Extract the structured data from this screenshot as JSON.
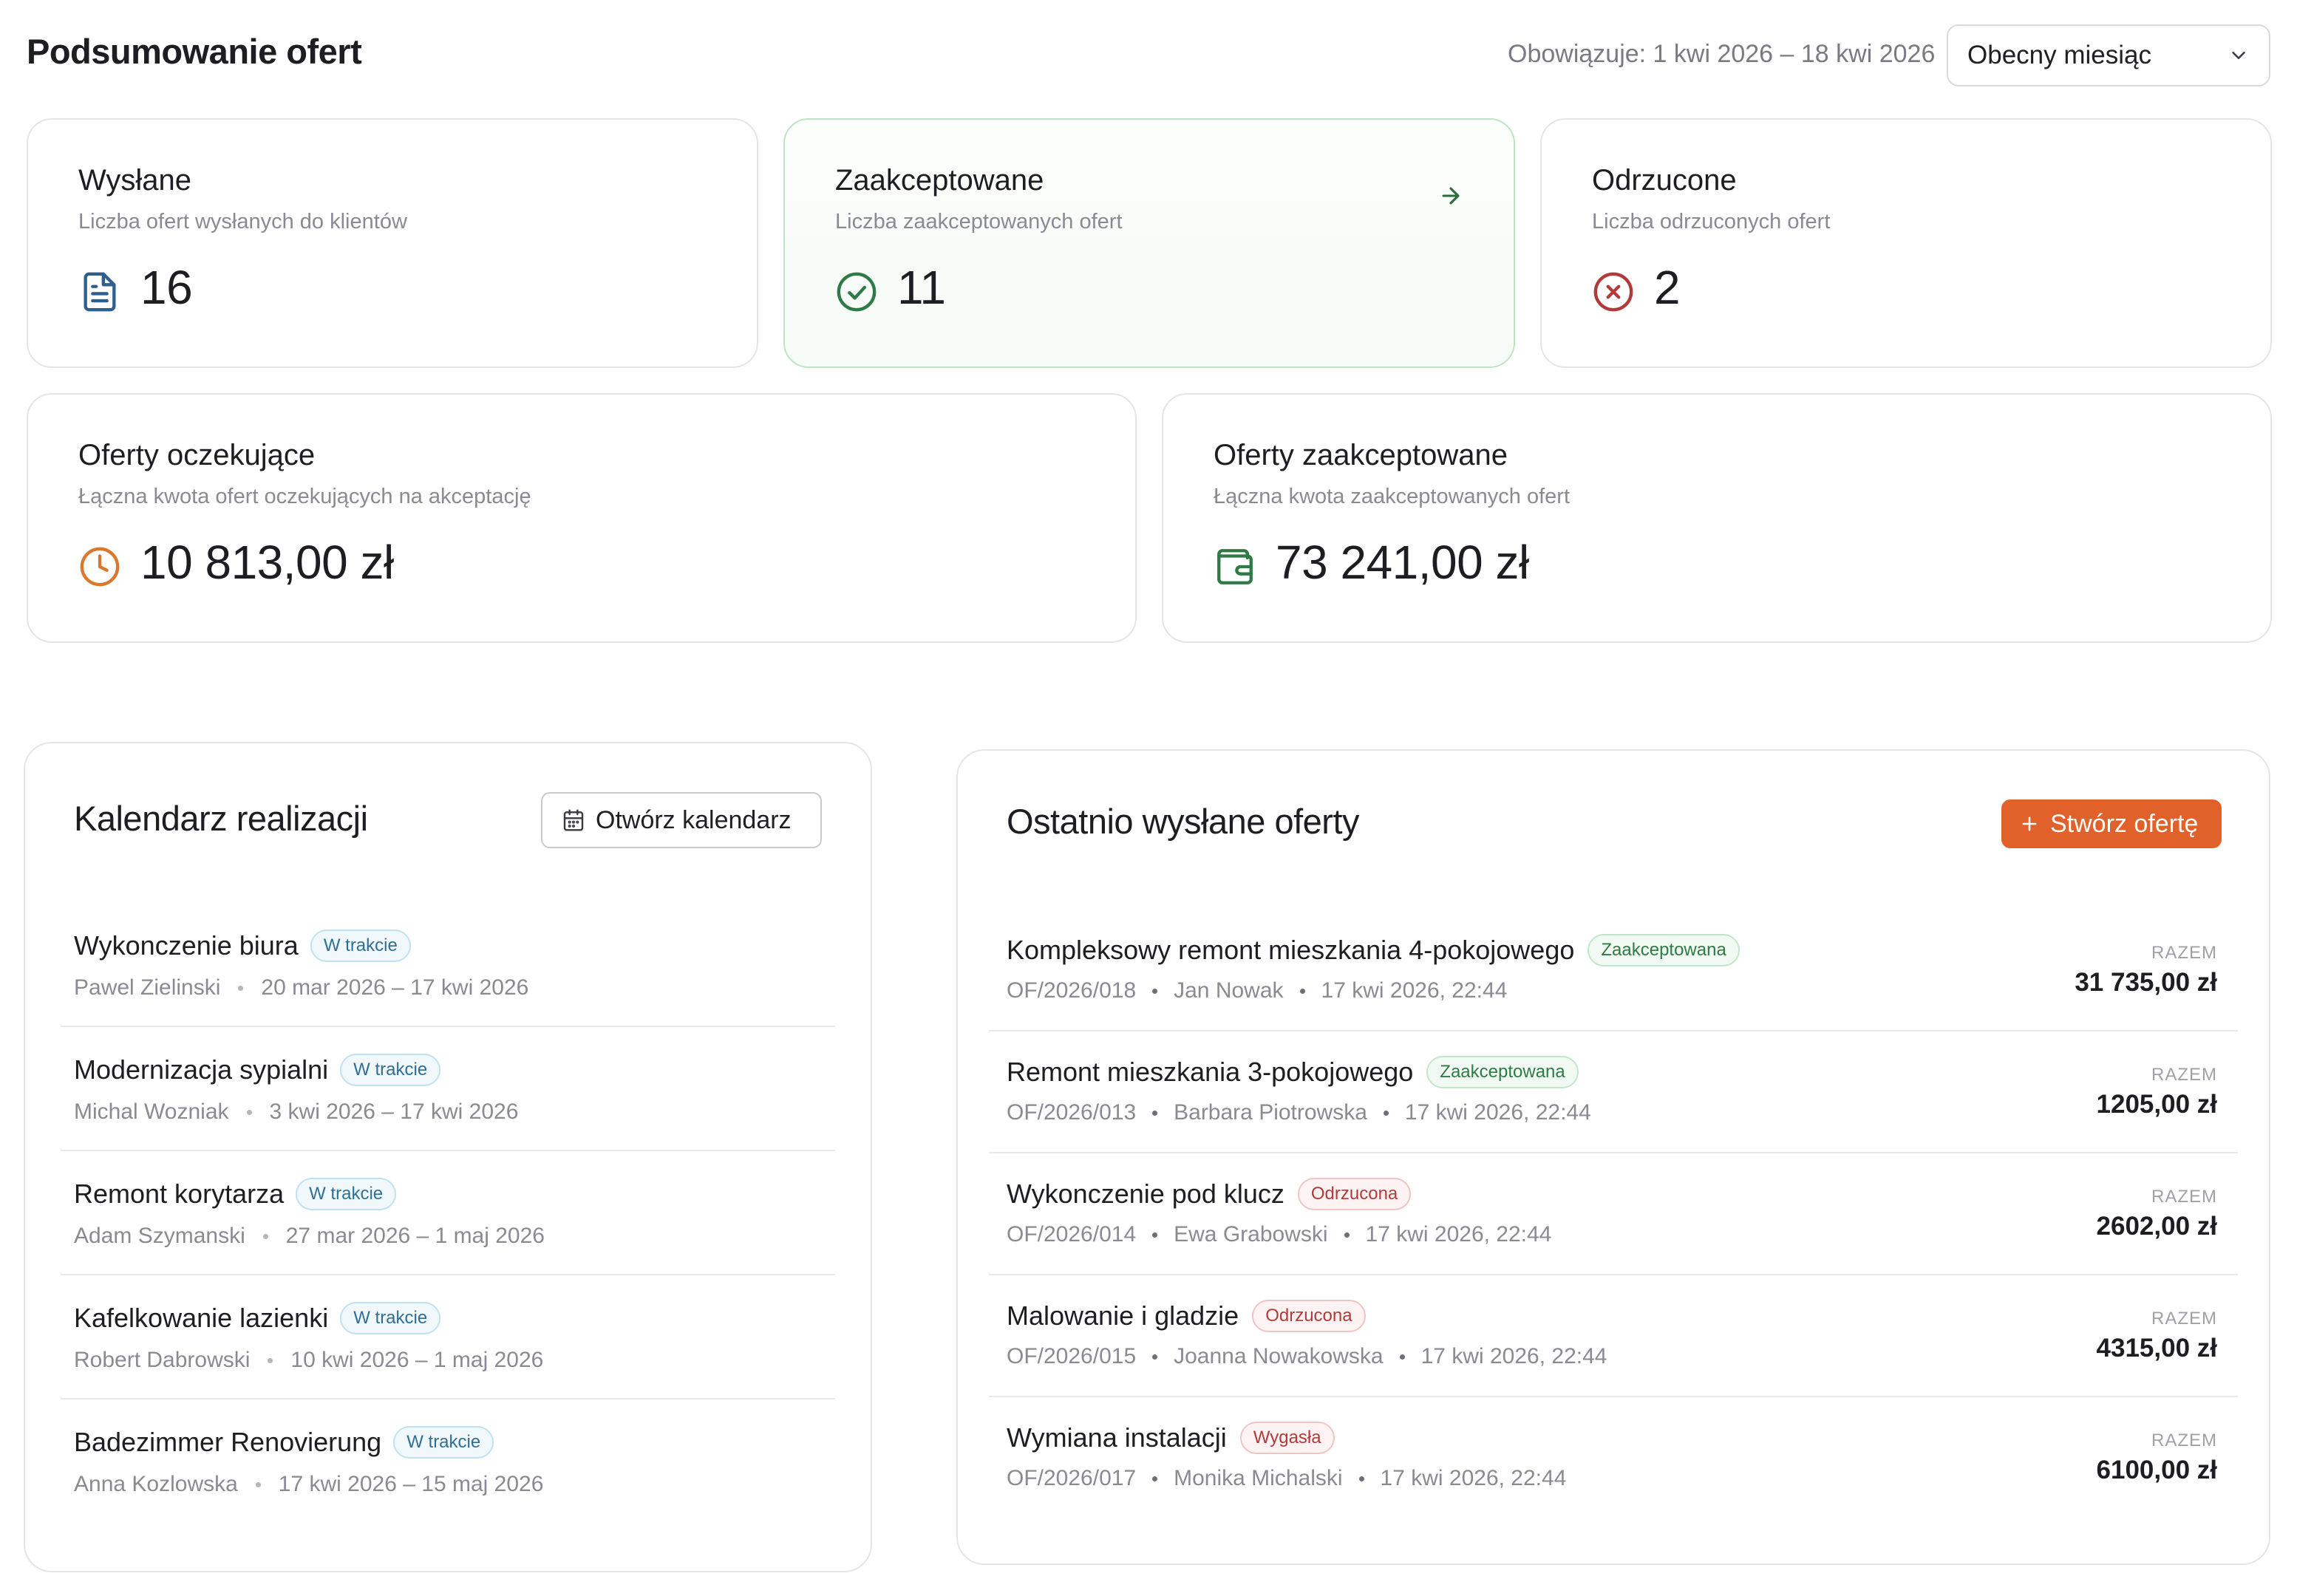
{
  "header": {
    "title": "Podsumowanie ofert",
    "validity": "Obowiązuje: 1 kwi 2026 – 18 kwi 2026",
    "period_select": "Obecny miesiąc"
  },
  "stats": {
    "sent": {
      "title": "Wysłane",
      "subtitle": "Liczba ofert wysłanych do klientów",
      "value": "16",
      "icon": "document-icon",
      "color": "#2f5f8f"
    },
    "accepted": {
      "title": "Zaakceptowane",
      "subtitle": "Liczba zaakceptowanych ofert",
      "value": "11",
      "icon": "check-circle-icon",
      "color": "#2f7a45"
    },
    "rejected": {
      "title": "Odrzucone",
      "subtitle": "Liczba odrzuconych ofert",
      "value": "2",
      "icon": "x-circle-icon",
      "color": "#b23a3a"
    },
    "pending_amount": {
      "title": "Oferty oczekujące",
      "subtitle": "Łączna kwota ofert oczekujących na akceptację",
      "value": "10 813,00 zł",
      "icon": "clock-icon",
      "color": "#d9782f"
    },
    "accepted_amount": {
      "title": "Oferty zaakceptowane",
      "subtitle": "Łączna kwota zaakceptowanych ofert",
      "value": "73 241,00 zł",
      "icon": "wallet-icon",
      "color": "#2f7a45"
    }
  },
  "calendar": {
    "title": "Kalendarz realizacji",
    "open_button": "Otwórz kalendarz",
    "items": [
      {
        "title": "Wykonczenie biura",
        "status": "W trakcie",
        "person": "Pawel Zielinski",
        "dates": "20 mar 2026 – 17 kwi 2026"
      },
      {
        "title": "Modernizacja sypialni",
        "status": "W trakcie",
        "person": "Michal Wozniak",
        "dates": "3 kwi 2026 – 17 kwi 2026"
      },
      {
        "title": "Remont korytarza",
        "status": "W trakcie",
        "person": "Adam Szymanski",
        "dates": "27 mar 2026 – 1 maj 2026"
      },
      {
        "title": "Kafelkowanie lazienki",
        "status": "W trakcie",
        "person": "Robert Dabrowski",
        "dates": "10 kwi 2026 – 1 maj 2026"
      },
      {
        "title": "Badezimmer Renovierung",
        "status": "W trakcie",
        "person": "Anna Kozlowska",
        "dates": "17 kwi 2026 – 15 maj 2026"
      }
    ]
  },
  "offers": {
    "title": "Ostatnio wysłane oferty",
    "create_button": "Stwórz ofertę",
    "items": [
      {
        "title": "Kompleksowy remont mieszkania 4-pokojowego",
        "status": "Zaakceptowana",
        "number": "OF/2026/018",
        "client": "Jan Nowak",
        "date": "17 kwi 2026, 22:44",
        "label": "RAZEM",
        "amount": "31 735,00 zł"
      },
      {
        "title": "Remont mieszkania 3-pokojowego",
        "status": "Zaakceptowana",
        "number": "OF/2026/013",
        "client": "Barbara Piotrowska",
        "date": "17 kwi 2026, 22:44",
        "label": "RAZEM",
        "amount": "1205,00 zł"
      },
      {
        "title": "Wykonczenie pod klucz",
        "status": "Odrzucona",
        "number": "OF/2026/014",
        "client": "Ewa Grabowski",
        "date": "17 kwi 2026, 22:44",
        "label": "RAZEM",
        "amount": "2602,00 zł"
      },
      {
        "title": "Malowanie i gladzie",
        "status": "Odrzucona",
        "number": "OF/2026/015",
        "client": "Joanna Nowakowska",
        "date": "17 kwi 2026, 22:44",
        "label": "RAZEM",
        "amount": "4315,00 zł"
      },
      {
        "title": "Wymiana instalacji",
        "status": "Wygasła",
        "number": "OF/2026/017",
        "client": "Monika Michalski",
        "date": "17 kwi 2026, 22:44",
        "label": "RAZEM",
        "amount": "6100,00 zł"
      }
    ]
  },
  "colors": {
    "accent_orange": "#e0612a",
    "border": "#e4e4e9",
    "muted_text": "#8a8a92"
  }
}
